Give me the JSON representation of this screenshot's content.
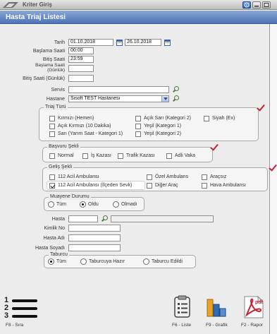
{
  "window": {
    "title": "Kriter Giriş"
  },
  "panel": {
    "title": "Hasta Triaj Listesi"
  },
  "dates": {
    "tarih_label": "Tarih",
    "tarih_start": "01.10.2018",
    "tarih_end": "26.10.2018",
    "baslama_saati_label": "Başlama Saati",
    "baslama_saati": "00:00",
    "bitis_saati_label": "Bitiş Saati",
    "bitis_saati": "23:59",
    "baslama_gunluk_label_1": "Başlama Saati",
    "baslama_gunluk_label_2": "(Günlük)",
    "bitis_gunluk_label": "Bitiş Saati (Günlük)"
  },
  "servis": {
    "label": "Servis",
    "value": ""
  },
  "hastane": {
    "label": "Hastane",
    "value": "Sisoft TEST Hastanesi"
  },
  "triaj": {
    "legend": "Triaj Türü",
    "options": [
      "Kırmızı (Hemen)",
      "Açık Sarı (Kategori 2)",
      "Siyah (Ex)",
      "Açık Kırmızı (10 Dakika)",
      "Yeşil (Kategori 1)",
      "Sarı (Yarım Saat - Kategori 1)",
      "Yeşil (Kategori 2)"
    ]
  },
  "basvuru": {
    "legend": "Başvuru Şekli",
    "options": [
      "Normal",
      "İş Kazası",
      "Trafik Kazası",
      "Adli Vaka"
    ]
  },
  "gelis": {
    "legend": "Geliş Şekli",
    "options": [
      "112 Acil Ambulansı",
      "Özel Ambulans",
      "Araçsız",
      "112 Acil Ambulansı (İlçeden Sevk)",
      "Diğer Araç",
      "Hava Ambulansı"
    ]
  },
  "muayene": {
    "legend": "Muayene Durumu",
    "options": [
      "Tüm",
      "Oldu",
      "Olmadı"
    ],
    "selected": "Oldu"
  },
  "hasta": {
    "hasta_label": "Hasta",
    "kimlik_label": "Kimlik No",
    "adi_label": "Hasta Adı",
    "soyadi_label": "Hasta Soyadı"
  },
  "taburcu": {
    "legend": "Taburcu",
    "options": [
      "Tüm",
      "Taburcuya Hazır",
      "Taburcu Edildi"
    ],
    "selected": "Tüm"
  },
  "footer": {
    "sira_label": "F8 - Sıra",
    "sira_numbers": [
      "1",
      "2",
      "3"
    ],
    "liste_label": "F6 - Liste",
    "grafik_label": "F9 - Grafik",
    "rapor_label": "F2 - Rapor",
    "pdf_text": "pdf"
  },
  "colors": {
    "header": "#4e74b6",
    "check_red": "#c62233",
    "pdf_red": "#c62233",
    "chart_orange": "#e9a227",
    "chart_blue": "#2f6db4"
  }
}
